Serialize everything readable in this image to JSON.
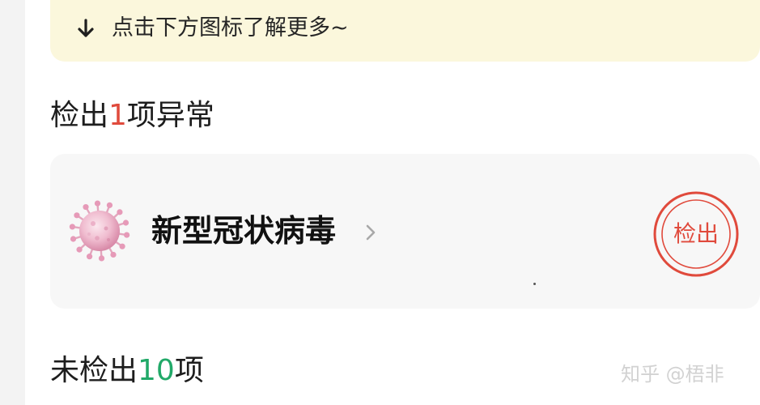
{
  "tip_banner": {
    "text": "点击下方图标了解更多~",
    "icon": "arrow-down-icon"
  },
  "detected_section": {
    "prefix": "检出",
    "count": "1",
    "suffix": "项异常",
    "count_color": "#e04a3c"
  },
  "result_card": {
    "name": "新型冠状病毒",
    "icon": "virus-icon",
    "chevron_icon": "chevron-right-icon",
    "status_label": "检出",
    "status_color": "#e04a3c"
  },
  "undetected_section": {
    "prefix": "未检出",
    "count": "10",
    "suffix": "项",
    "count_color": "#21a968"
  },
  "watermark": "知乎 @梧非",
  "colors": {
    "banner_background": "#fbf7dc",
    "card_background": "#f7f7f7",
    "page_background": "#ffffff"
  }
}
